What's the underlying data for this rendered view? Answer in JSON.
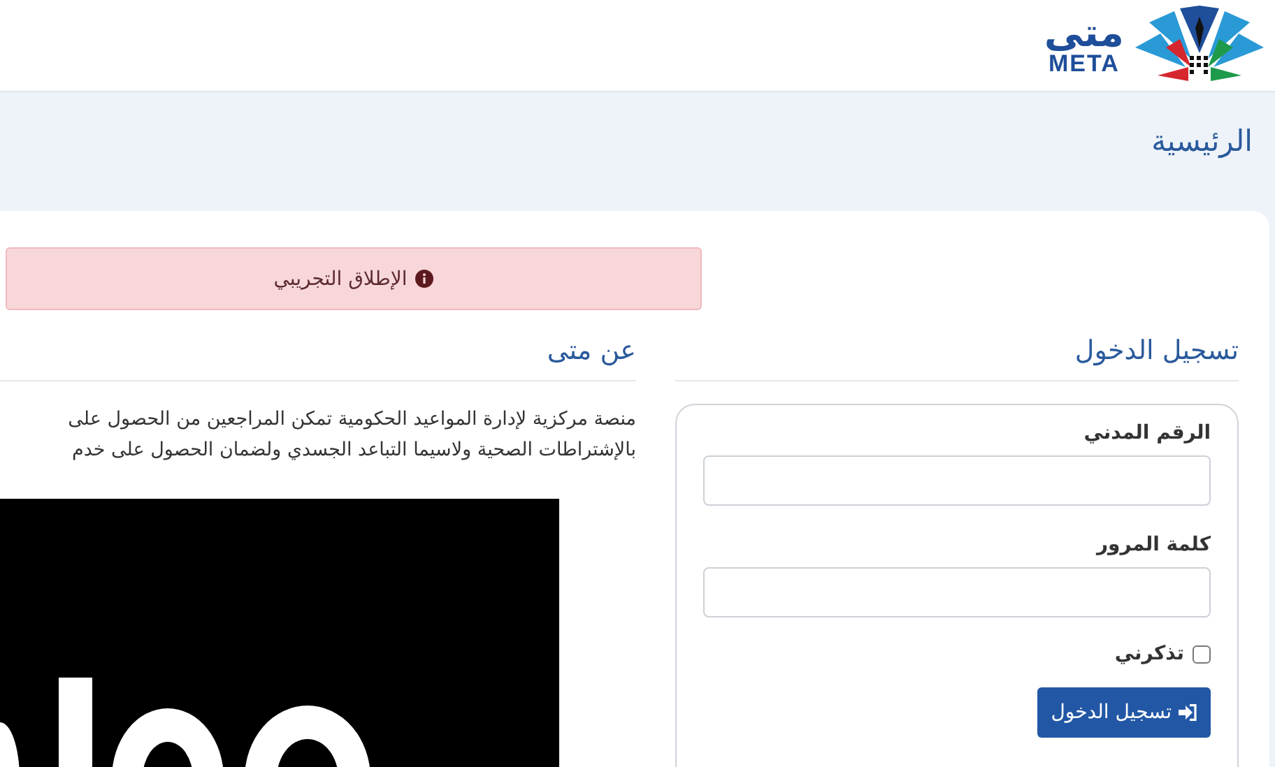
{
  "logo": {
    "arabic": "متى",
    "latin": "META"
  },
  "breadcrumb": "الرئيسية",
  "alert": {
    "text": "الإطلاق التجريبي"
  },
  "about": {
    "title": "عن متى",
    "lines": [
      "منصة مركزية لإدارة المواعيد الحكومية تمكن المراجعين من الحصول على",
      "بالإشتراطات الصحية ولاسيما التباعد الجسدي ولضمان الحصول على خدم"
    ]
  },
  "login": {
    "title": "تسجيل الدخول",
    "fields": [
      {
        "label": "الرقم المدني"
      },
      {
        "label": "كلمة المرور"
      }
    ],
    "remember": {
      "label": "تذكرني",
      "checked": false
    },
    "button": "تسجيل الدخول"
  }
}
